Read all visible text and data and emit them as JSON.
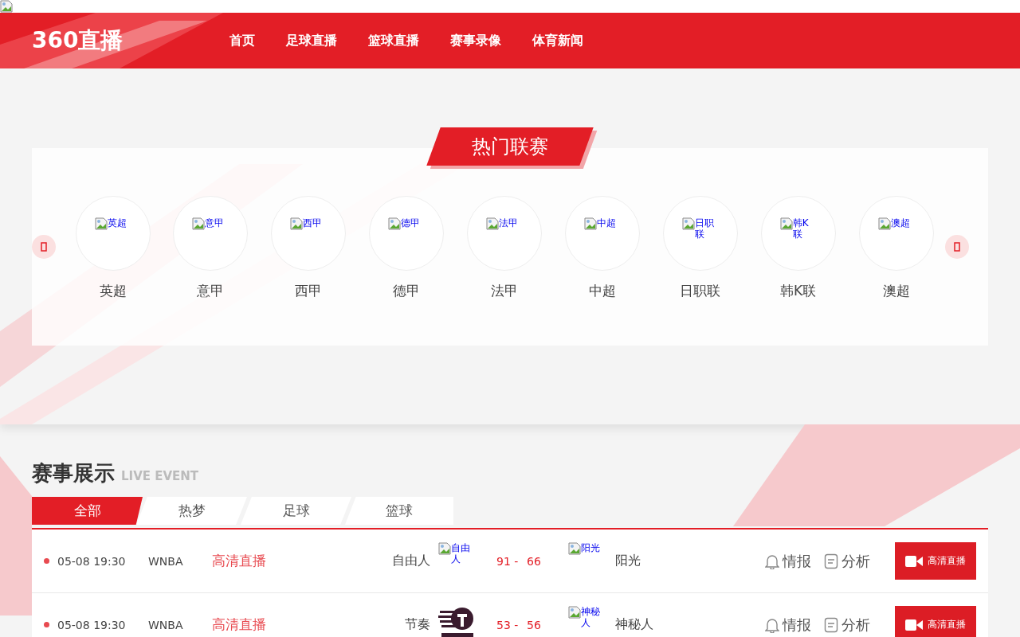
{
  "header": {
    "logo": "360直播",
    "nav": [
      {
        "label": "首页"
      },
      {
        "label": "足球直播"
      },
      {
        "label": "篮球直播"
      },
      {
        "label": "赛事录像"
      },
      {
        "label": "体育新闻"
      }
    ]
  },
  "leagues": {
    "title": "热门联赛",
    "items": [
      {
        "name": "英超",
        "logo_alt": "英超"
      },
      {
        "name": "意甲",
        "logo_alt": "意甲"
      },
      {
        "name": "西甲",
        "logo_alt": "西甲"
      },
      {
        "name": "德甲",
        "logo_alt": "德甲"
      },
      {
        "name": "法甲",
        "logo_alt": "法甲"
      },
      {
        "name": "中超",
        "logo_alt": "中超"
      },
      {
        "name": "日职联",
        "logo_alt": "日职联"
      },
      {
        "name": "韩K联",
        "logo_alt": "韩K联"
      },
      {
        "name": "澳超",
        "logo_alt": "澳超"
      }
    ]
  },
  "events": {
    "title": "赛事展示",
    "subtitle": "LIVE EVENT",
    "tabs": [
      {
        "label": "全部",
        "selected": true
      },
      {
        "label": "热梦",
        "selected": false
      },
      {
        "label": "足球",
        "selected": false
      },
      {
        "label": "篮球",
        "selected": false
      }
    ],
    "rows": [
      {
        "time": "05-08 19:30",
        "league": "WNBA",
        "stream_link": "高清直播",
        "home": "自由人",
        "home_logo": {
          "kind": "broken",
          "alt": "自由人"
        },
        "home_score": "91 -",
        "away_score": "66",
        "away_logo": {
          "kind": "broken",
          "alt": "阳光"
        },
        "away": "阳光",
        "intel": "情报",
        "analysis": "分析",
        "button": "高清直播"
      },
      {
        "time": "05-08 19:30",
        "league": "WNBA",
        "stream_link": "高清直播",
        "home": "节奏",
        "home_logo": {
          "kind": "emblem"
        },
        "home_score": "53 -",
        "away_score": "56",
        "away_logo": {
          "kind": "broken",
          "alt": "神秘人"
        },
        "away": "神秘人",
        "intel": "情报",
        "analysis": "分析",
        "button": "高清直播"
      }
    ]
  }
}
